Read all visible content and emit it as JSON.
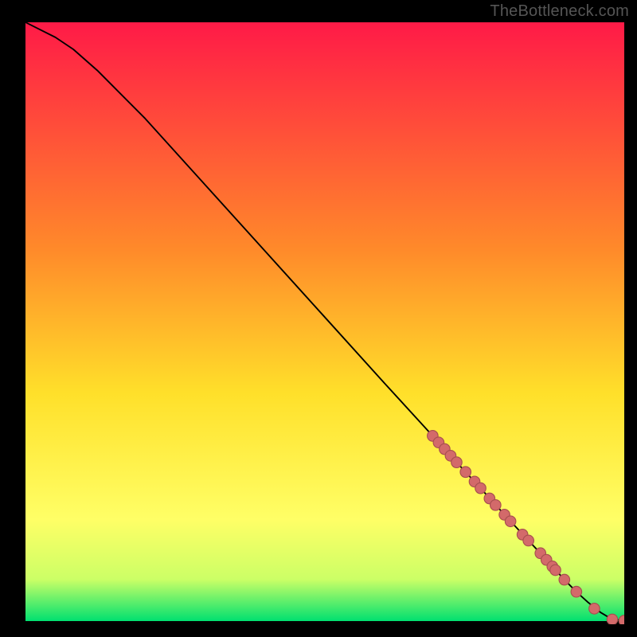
{
  "attribution": "TheBottleneck.com",
  "colors": {
    "point_fill": "#d36a6a",
    "point_stroke": "#a74f4f",
    "curve": "#000000",
    "bg_top": "#ff1a47",
    "bg_mid1": "#ff8a2a",
    "bg_mid2": "#ffe02a",
    "bg_mid3": "#ffff66",
    "bg_mid4": "#ccff66",
    "bg_bottom": "#00e070",
    "frame": "#000000"
  },
  "chart_data": {
    "type": "line",
    "title": "",
    "xlabel": "",
    "ylabel": "",
    "xlim": [
      0,
      100
    ],
    "ylim": [
      0,
      100
    ],
    "grid": false,
    "legend": false,
    "series": [
      {
        "name": "curve",
        "kind": "line",
        "x": [
          0,
          2,
          5,
          8,
          12,
          20,
          30,
          40,
          50,
          60,
          68,
          72,
          76,
          80,
          84,
          86,
          88,
          90,
          92,
          94,
          96,
          98,
          100
        ],
        "y": [
          100,
          99,
          97.5,
          95.5,
          92,
          84,
          73,
          62,
          51,
          40,
          31.3,
          26.9,
          22.6,
          18.2,
          13.9,
          11.8,
          9.6,
          7.4,
          5.4,
          3.6,
          2.0,
          0.8,
          0.6
        ]
      },
      {
        "name": "points",
        "kind": "scatter",
        "x": [
          68,
          69,
          70,
          71,
          72,
          73.5,
          75,
          76,
          77.5,
          78.5,
          80,
          81,
          83,
          84,
          86,
          87,
          88,
          88.5,
          90,
          92,
          95,
          98,
          100
        ],
        "y": [
          31.3,
          30.2,
          29.1,
          28.0,
          26.9,
          25.3,
          23.7,
          22.6,
          20.9,
          19.8,
          18.2,
          17.1,
          14.9,
          13.9,
          11.8,
          10.7,
          9.6,
          9.0,
          7.4,
          5.4,
          2.6,
          0.8,
          0.6
        ]
      }
    ]
  }
}
